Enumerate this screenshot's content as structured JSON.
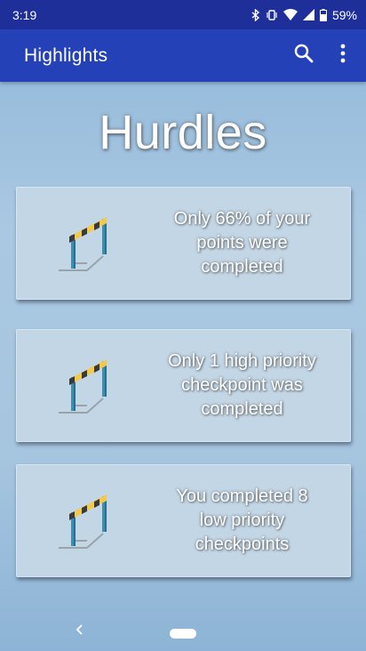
{
  "status_bar": {
    "time": "3:19",
    "battery": "59%",
    "icons": [
      "bluetooth-icon",
      "vibrate-icon",
      "wifi-icon",
      "signal-icon",
      "battery-icon"
    ]
  },
  "app_bar": {
    "title": "Highlights",
    "actions": [
      "search-icon",
      "more-vert-icon"
    ]
  },
  "page": {
    "heading": "Hurdles"
  },
  "cards": [
    {
      "icon": "hurdle-icon",
      "line1": "Only 66% of your",
      "line2": "points were",
      "line3": "completed"
    },
    {
      "icon": "hurdle-icon",
      "line1": "Only 1 high priority",
      "line2": "checkpoint was",
      "line3": "completed"
    },
    {
      "icon": "hurdle-icon",
      "line1": "You completed 8",
      "line2": "low priority",
      "line3": "checkpoints"
    }
  ],
  "nav_bar": {
    "buttons": [
      "back-icon",
      "home-pill"
    ]
  },
  "colors": {
    "status_bar": "#1f2f9a",
    "app_bar": "#2541b8",
    "background": "#a9c8e2",
    "card": "#c3d6e6"
  }
}
